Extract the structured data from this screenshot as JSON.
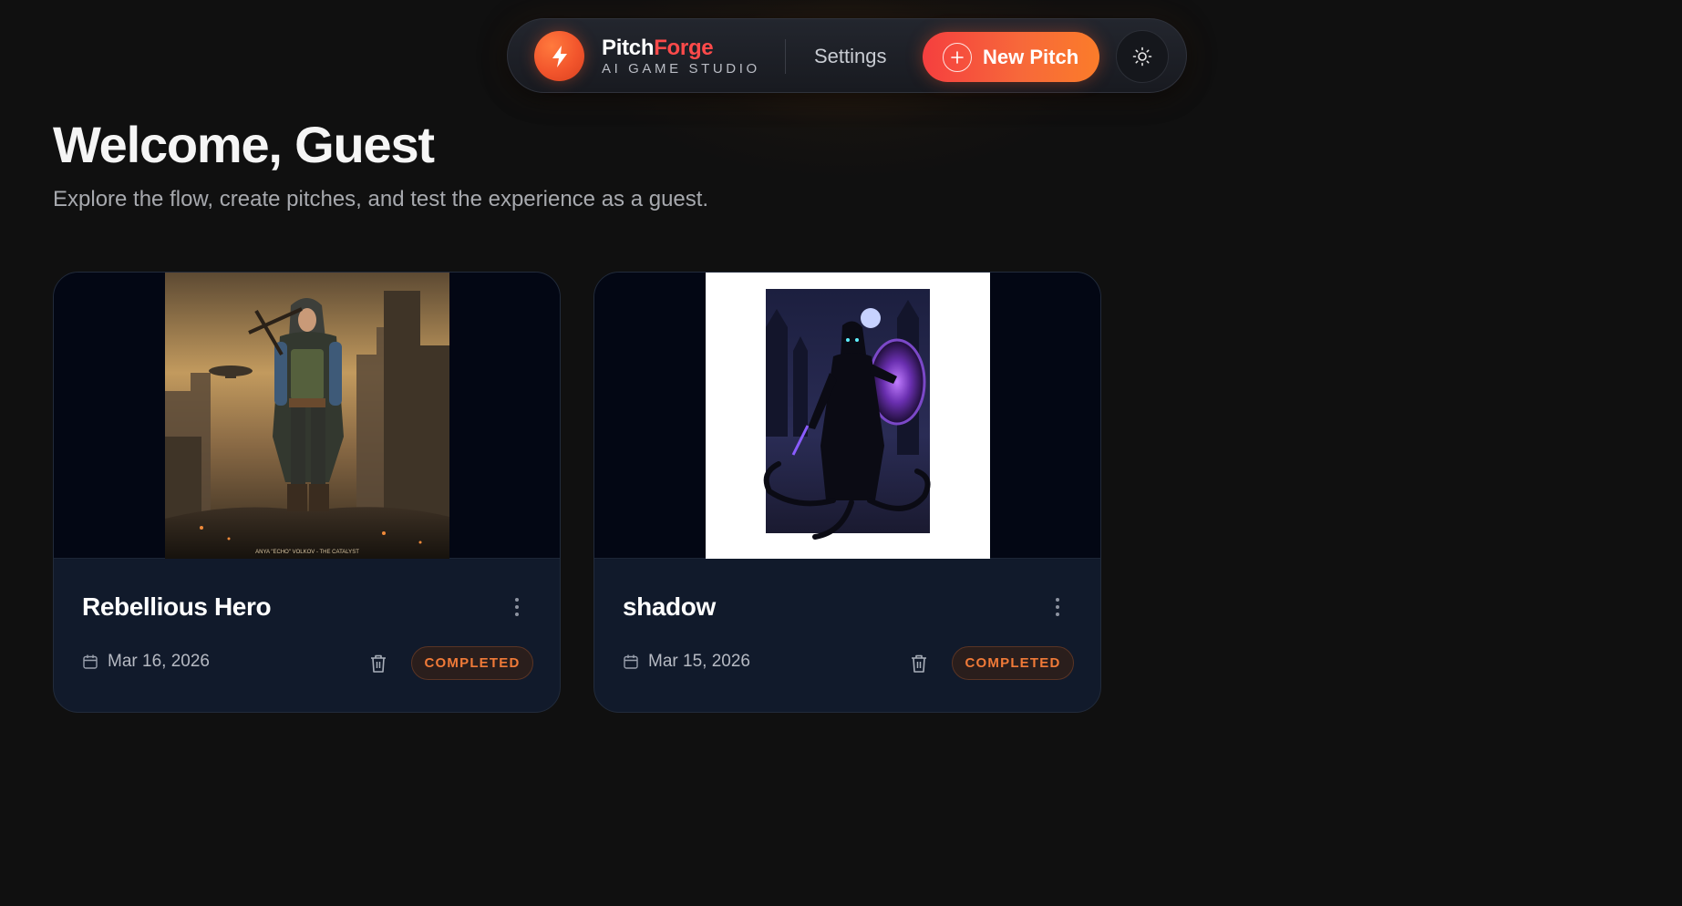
{
  "nav": {
    "brand_part1": "Pitch",
    "brand_part2": "Forge",
    "brand_tagline": "AI GAME STUDIO",
    "logo_icon": "lightning-bolt-icon",
    "settings_label": "Settings",
    "new_pitch_label": "New Pitch",
    "new_pitch_icon": "plus-circle-icon",
    "theme_toggle_icon": "sun-icon",
    "accent_color": "#f7683a",
    "brand_accent_color": "#ff4a4a"
  },
  "header": {
    "title": "Welcome, Guest",
    "subtitle": "Explore the flow, create pitches, and test the experience as a guest."
  },
  "pitches": [
    {
      "title": "Rebellious Hero",
      "date": "Mar 16, 2026",
      "status": "COMPLETED",
      "art_caption": "ANYA \"ECHO\" VOLKOV - THE CATALYST"
    },
    {
      "title": "shadow",
      "date": "Mar 15, 2026",
      "status": "COMPLETED"
    }
  ],
  "status_color": "#f07a38"
}
